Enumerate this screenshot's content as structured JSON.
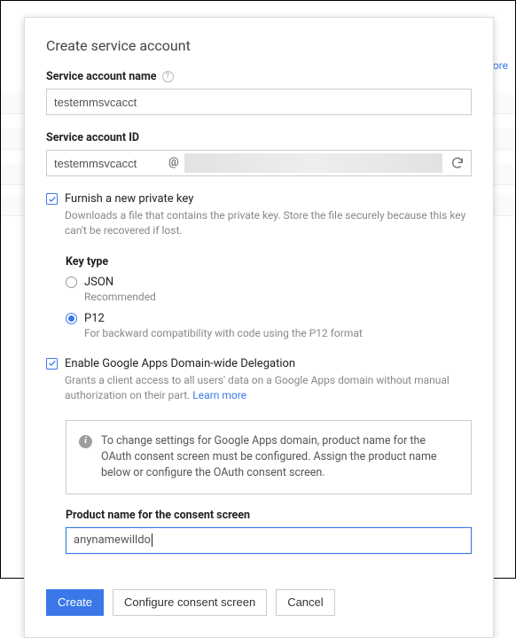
{
  "background": {
    "more_link": "more"
  },
  "dialog": {
    "title": "Create service account",
    "service_name": {
      "label": "Service account name",
      "value": "testemmsvcacct"
    },
    "service_id": {
      "label": "Service account ID",
      "value": "testemmsvcacct",
      "at": "@"
    },
    "furnish": {
      "label": "Furnish a new private key",
      "desc": "Downloads a file that contains the private key. Store the file securely because this key can't be recovered if lost."
    },
    "key_type": {
      "title": "Key type",
      "json": {
        "label": "JSON",
        "desc": "Recommended"
      },
      "p12": {
        "label": "P12",
        "desc": "For backward compatibility with code using the P12 format"
      }
    },
    "delegation": {
      "label": "Enable Google Apps Domain-wide Delegation",
      "desc": "Grants a client access to all users' data on a Google Apps domain without manual authorization on their part.",
      "learn_more": "Learn more"
    },
    "info": {
      "text": "To change settings for Google Apps domain, product name for the OAuth consent screen must be configured. Assign the product name below or configure the OAuth consent screen."
    },
    "product_name": {
      "label": "Product name for the consent screen",
      "value": "anynamewilldo"
    },
    "buttons": {
      "create": "Create",
      "configure": "Configure consent screen",
      "cancel": "Cancel"
    }
  }
}
